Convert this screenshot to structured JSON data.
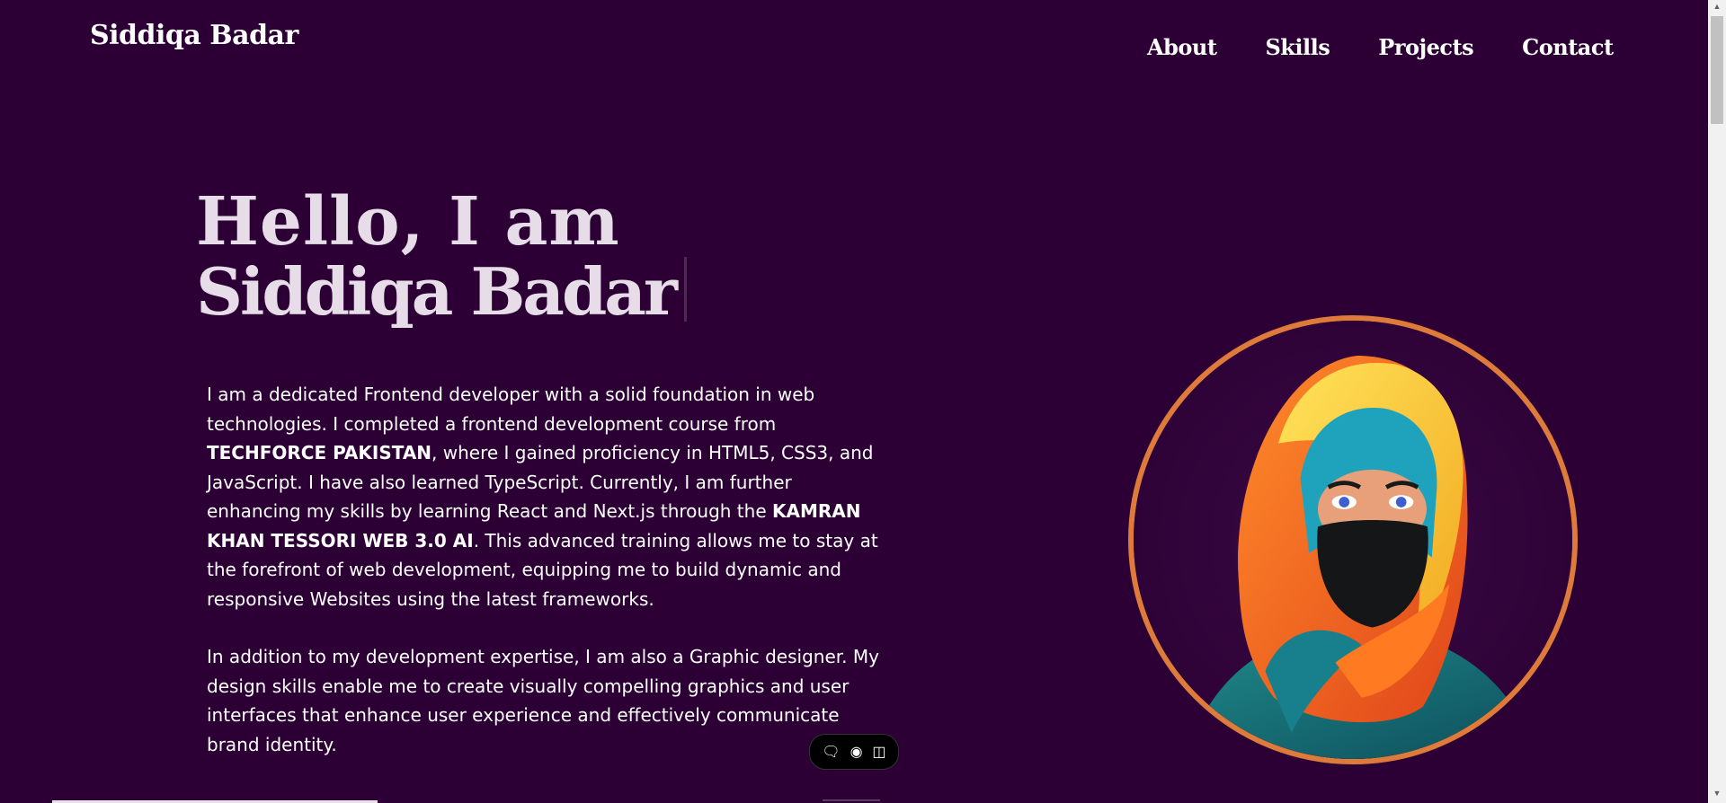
{
  "header": {
    "logo": "Siddiqa Badar",
    "nav": [
      "About",
      "Skills",
      "Projects",
      "Contact"
    ]
  },
  "hero": {
    "greeting": "Hello, I am",
    "name": "Siddiqa Badar"
  },
  "bio": {
    "p1_a": "I am a dedicated Frontend developer with a solid foundation in web technologies. I completed a frontend development course from ",
    "p1_b": "TECHFORCE PAKISTAN",
    "p1_c": ", where I gained proficiency in HTML5, CSS3, and JavaScript. I have also learned TypeScript. Currently, I am further enhancing my skills by learning React and Next.js through the ",
    "p1_d": "KAMRAN KHAN TESSORI WEB 3.0 AI",
    "p1_e": ". This advanced training allows me to stay at the forefront of web development, equipping me to build dynamic and responsive Websites using the latest frameworks.",
    "p2": "In addition to my development expertise, I am also a Graphic designer. My design skills enable me to create visually compelling graphics and user interfaces that enhance user experience and effectively communicate brand identity."
  },
  "toolbar": {
    "icons": [
      "chat-icon",
      "eye-icon",
      "panel-icon"
    ]
  },
  "colors": {
    "background": "#2c0035",
    "ring": "#de7a3a",
    "heading": "#e6dde8"
  }
}
